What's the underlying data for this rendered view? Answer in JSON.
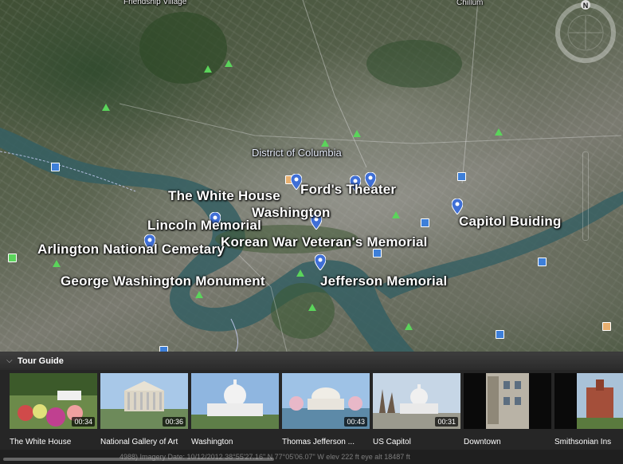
{
  "map": {
    "labels": {
      "friendship_village": "Friendship Village",
      "chillum": "Chillum",
      "district": "District of Columbia",
      "fords_theater": "Ford's Theater",
      "white_house": "The White House",
      "washington": "Washington",
      "capitol": "Capitol Buiding",
      "lincoln": "Lincoln Memorial",
      "korean": "Korean War Veteran's Memorial",
      "arlington": "Arlington National Cemetary",
      "george": "George Washington Monument",
      "jefferson": "Jefferson Memorial"
    },
    "compass_letter": "N",
    "colors": {
      "pin": "#3f6fd6",
      "tree": "#5bd45b",
      "water": "#355f63"
    }
  },
  "tour": {
    "title": "Tour Guide",
    "items": [
      {
        "name": "The White House",
        "duration": "00:34"
      },
      {
        "name": "National Gallery of Art",
        "duration": "00:36"
      },
      {
        "name": "Washington",
        "duration": ""
      },
      {
        "name": "Thomas Jefferson ...",
        "duration": "00:43"
      },
      {
        "name": "US Capitol",
        "duration": "00:31"
      },
      {
        "name": "Downtown",
        "duration": ""
      },
      {
        "name": "Smithsonian Ins",
        "duration": ""
      }
    ]
  },
  "status": {
    "text": "4988) Imagery Date: 10/12/2012   38°55'27.16\" N  77°05'06.07\" W  elev 222 ft  eye alt 18487 ft"
  }
}
